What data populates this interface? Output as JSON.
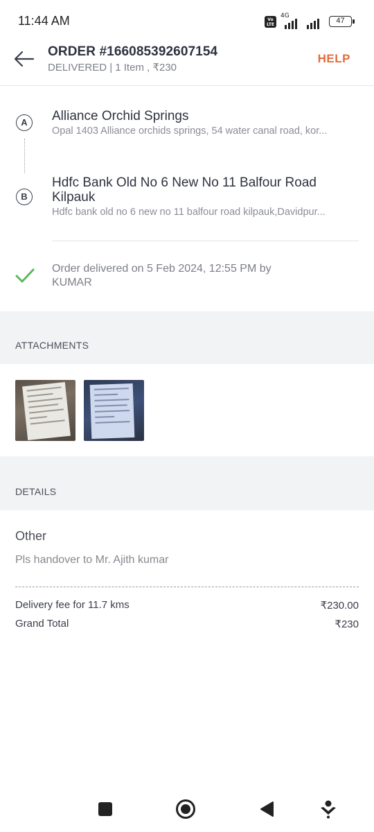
{
  "status_bar": {
    "time": "11:44 AM",
    "volte": "Vo LTE",
    "network": "4G",
    "battery": "47"
  },
  "header": {
    "order_title": "ORDER #166085392607154",
    "order_subtitle": "DELIVERED | 1 Item , ₹230",
    "help_label": "HELP"
  },
  "pickup": {
    "marker": "A",
    "name": "Alliance Orchid Springs",
    "address": "Opal 1403 Alliance orchids springs, 54 water canal road, kor..."
  },
  "drop": {
    "marker": "B",
    "name": "Hdfc Bank Old No 6 New No 11 Balfour Road Kilpauk",
    "address": "Hdfc bank old no 6 new no 11 balfour road kilpauk,Davidpur..."
  },
  "delivery_status": "Order delivered on 5 Feb 2024, 12:55 PM by KUMAR",
  "attachments": {
    "heading": "ATTACHMENTS",
    "count": 2
  },
  "details": {
    "heading": "DETAILS",
    "category": "Other",
    "note": "Pls handover to Mr. Ajith kumar",
    "fees": [
      {
        "label": "Delivery fee for 11.7 kms",
        "value": "₹230.00"
      },
      {
        "label": "Grand Total",
        "value": "₹230"
      }
    ]
  },
  "colors": {
    "accent": "#e46b3b",
    "success": "#5cb85c",
    "band": "#f2f3f5"
  }
}
